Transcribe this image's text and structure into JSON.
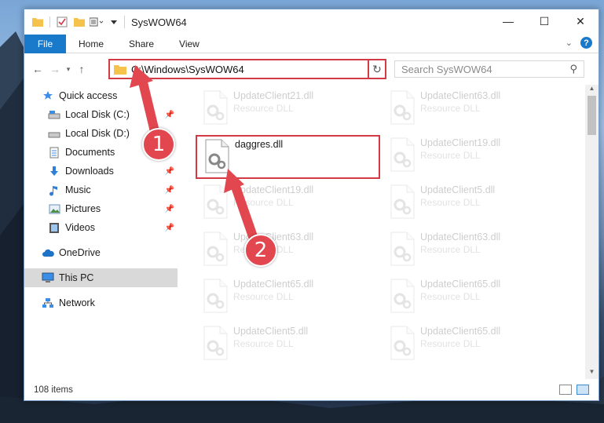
{
  "window": {
    "title": "SysWOW64",
    "controls": {
      "minimize": "—",
      "maximize": "☐",
      "close": "✕"
    }
  },
  "ribbon": {
    "file_tab": "File",
    "tabs": [
      "Home",
      "Share",
      "View"
    ],
    "help": "?"
  },
  "address": {
    "path": "C:\\Windows\\SysWOW64",
    "search_placeholder": "Search SysWOW64"
  },
  "nav": {
    "quick_access": "Quick access",
    "items": [
      {
        "label": "Local Disk (C:)",
        "icon": "drive-icon",
        "pinned": true
      },
      {
        "label": "Local Disk (D:)",
        "icon": "drive-icon",
        "pinned": false
      },
      {
        "label": "Documents",
        "icon": "documents-icon",
        "pinned": false
      },
      {
        "label": "Downloads",
        "icon": "downloads-icon",
        "pinned": true
      },
      {
        "label": "Music",
        "icon": "music-icon",
        "pinned": true
      },
      {
        "label": "Pictures",
        "icon": "pictures-icon",
        "pinned": true
      },
      {
        "label": "Videos",
        "icon": "videos-icon",
        "pinned": true
      }
    ],
    "onedrive": "OneDrive",
    "this_pc": "This PC",
    "network": "Network"
  },
  "files": {
    "col1": [
      {
        "name": "UpdateClient21.dll",
        "type": "Resource DLL",
        "faded": true
      },
      {
        "name": "daggres.dll",
        "type": "",
        "faded": false,
        "highlighted": true
      },
      {
        "name": "UpdateClient19.dll",
        "type": "Resource DLL",
        "faded": true
      },
      {
        "name": "UpdateClient63.dll",
        "type": "Resource DLL",
        "faded": true
      },
      {
        "name": "UpdateClient65.dll",
        "type": "Resource DLL",
        "faded": true
      },
      {
        "name": "UpdateClient5.dll",
        "type": "Resource DLL",
        "faded": true
      }
    ],
    "col2": [
      {
        "name": "UpdateClient63.dll",
        "type": "Resource DLL",
        "faded": true
      },
      {
        "name": "UpdateClient19.dll",
        "type": "Resource DLL",
        "faded": true
      },
      {
        "name": "UpdateClient5.dll",
        "type": "Resource DLL",
        "faded": true
      },
      {
        "name": "UpdateClient63.dll",
        "type": "Resource DLL",
        "faded": true
      },
      {
        "name": "UpdateClient65.dll",
        "type": "Resource DLL",
        "faded": true
      },
      {
        "name": "UpdateClient65.dll",
        "type": "Resource DLL",
        "faded": true
      }
    ]
  },
  "status": {
    "item_count": "108 items"
  },
  "annotations": {
    "step1": "1",
    "step2": "2",
    "color": "#e2474f"
  }
}
